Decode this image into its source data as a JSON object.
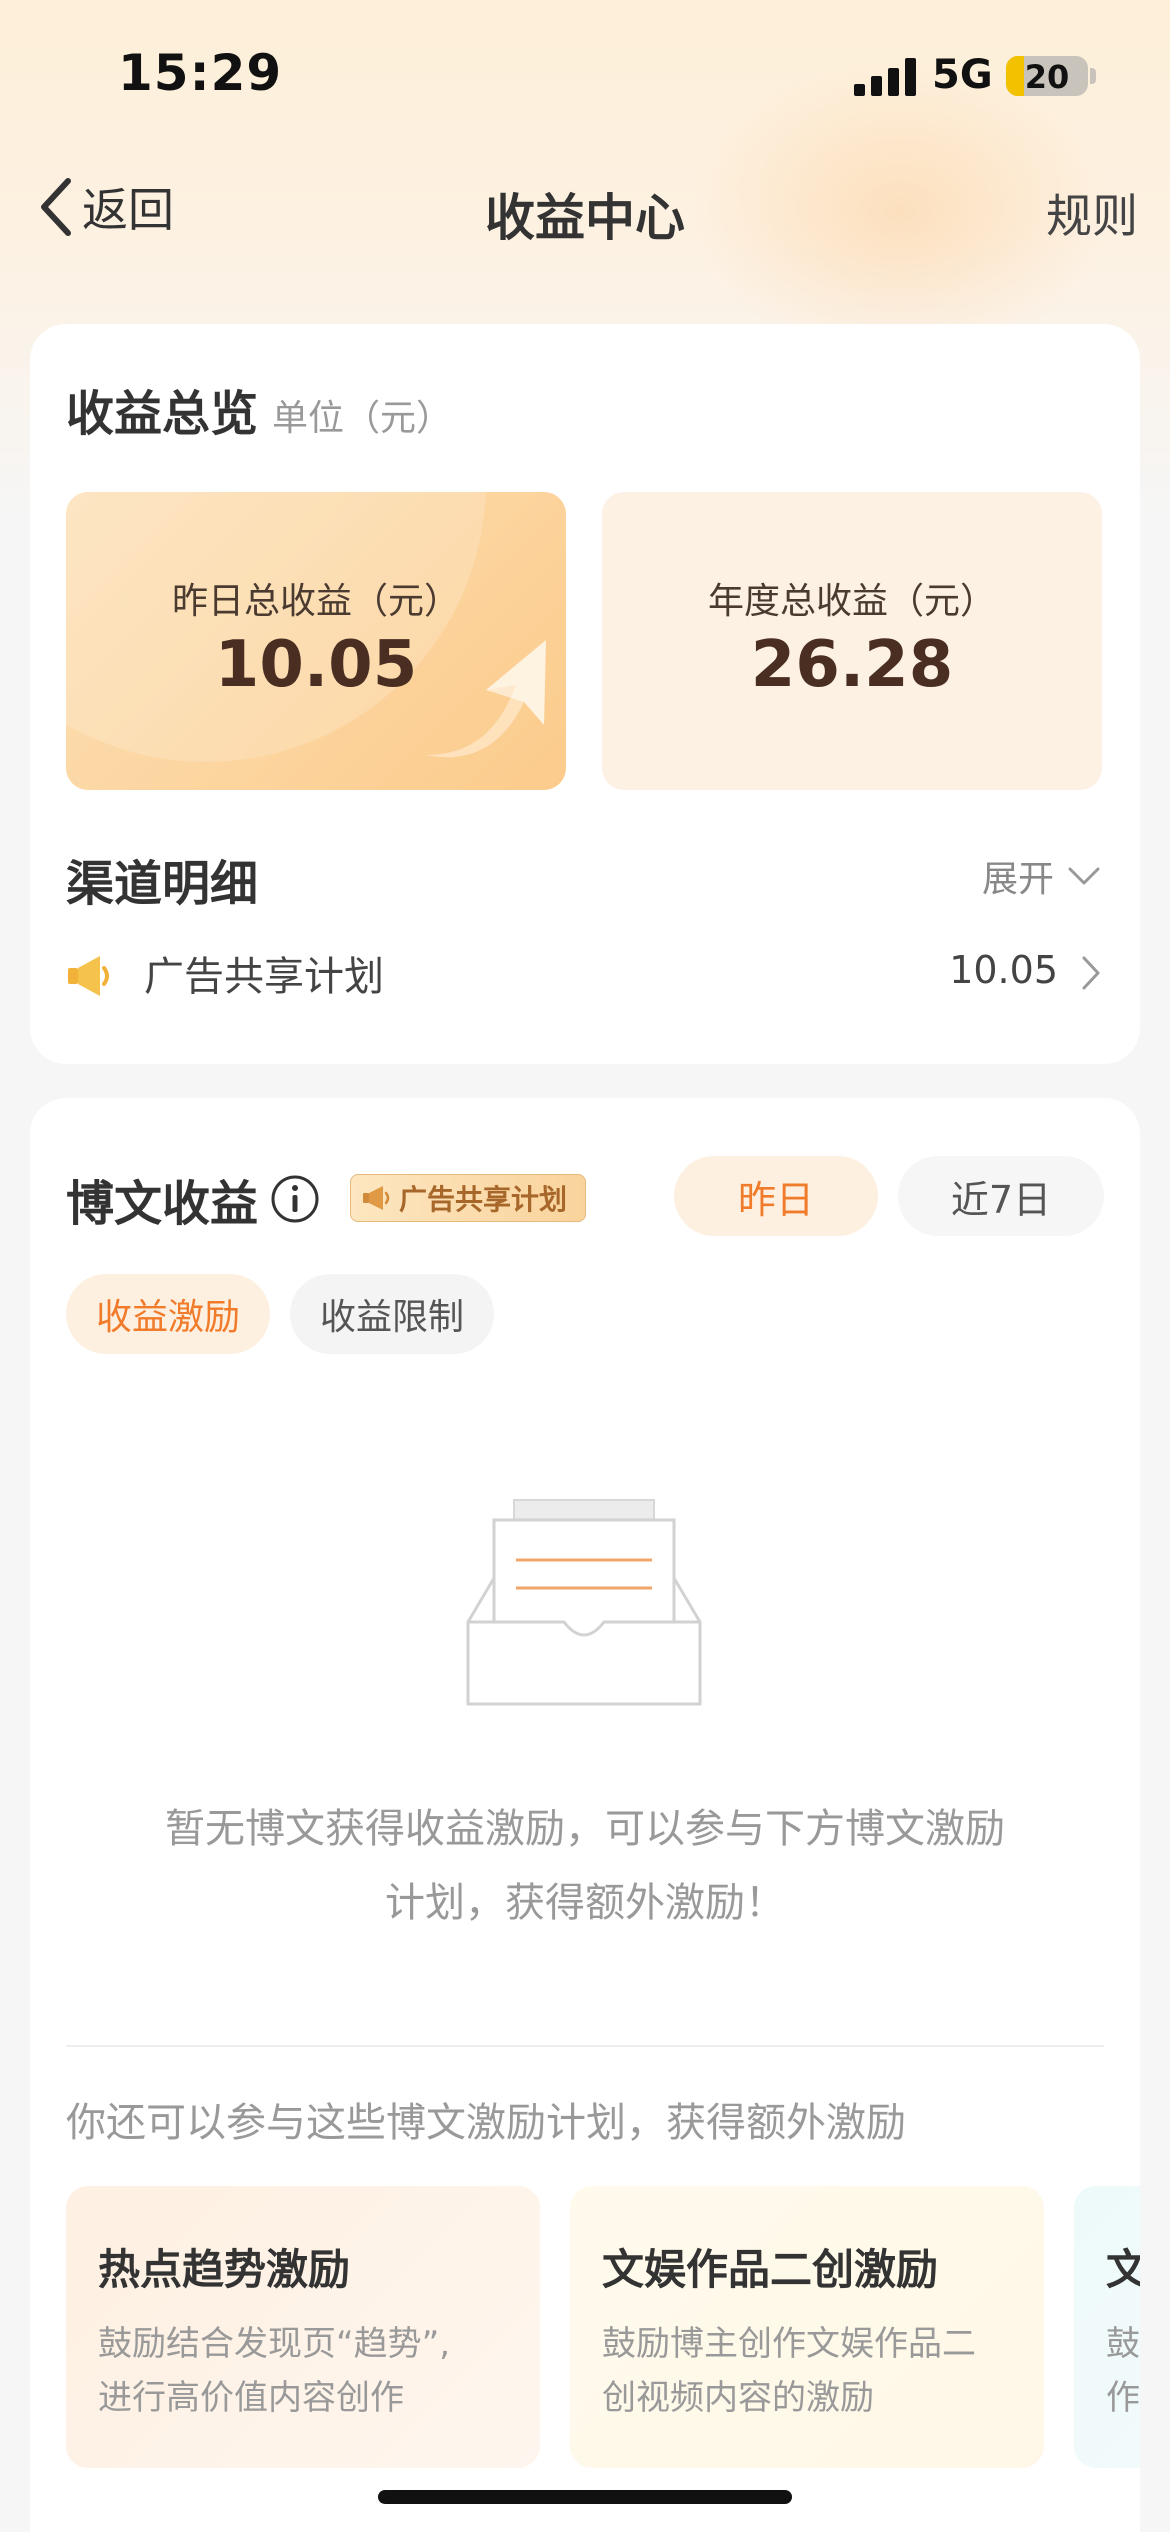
{
  "status_bar": {
    "time": "15:29",
    "network": "5G",
    "battery": "20"
  },
  "nav": {
    "back_label": "返回",
    "title": "收益中心",
    "rules_label": "规则"
  },
  "overview": {
    "title": "收益总览",
    "unit": "单位（元）",
    "yesterday_label": "昨日总收益（元）",
    "yesterday_value": "10.05",
    "annual_label": "年度总收益（元）",
    "annual_value": "26.28"
  },
  "channel": {
    "title": "渠道明细",
    "expand_label": "展开",
    "rows": [
      {
        "icon": "megaphone-icon",
        "label": "广告共享计划",
        "value": "10.05"
      }
    ]
  },
  "post_earnings": {
    "title": "博文收益",
    "tag": "广告共享计划",
    "period_tabs": [
      "昨日",
      "近7日"
    ],
    "sub_tabs": [
      "收益激励",
      "收益限制"
    ],
    "empty_line1": "暂无博文获得收益激励，可以参与下方博文激励",
    "empty_line2": "计划，获得额外激励！",
    "more_text": "你还可以参与这些博文激励计划，获得额外激励",
    "promos": [
      {
        "title": "热点趋势激励",
        "desc_line1": "鼓励结合发现页“趋势”,",
        "desc_line2": "进行高价值内容创作"
      },
      {
        "title": "文娱作品二创激励",
        "desc_line1": "鼓励博主创作文娱作品二",
        "desc_line2": "创视频内容的激励"
      },
      {
        "title": "文",
        "desc_line1": "鼓",
        "desc_line2": "作"
      }
    ]
  },
  "colors": {
    "accent": "#f07b2b",
    "brown_value": "#4a2e22",
    "card_bg": "#ffffff"
  }
}
